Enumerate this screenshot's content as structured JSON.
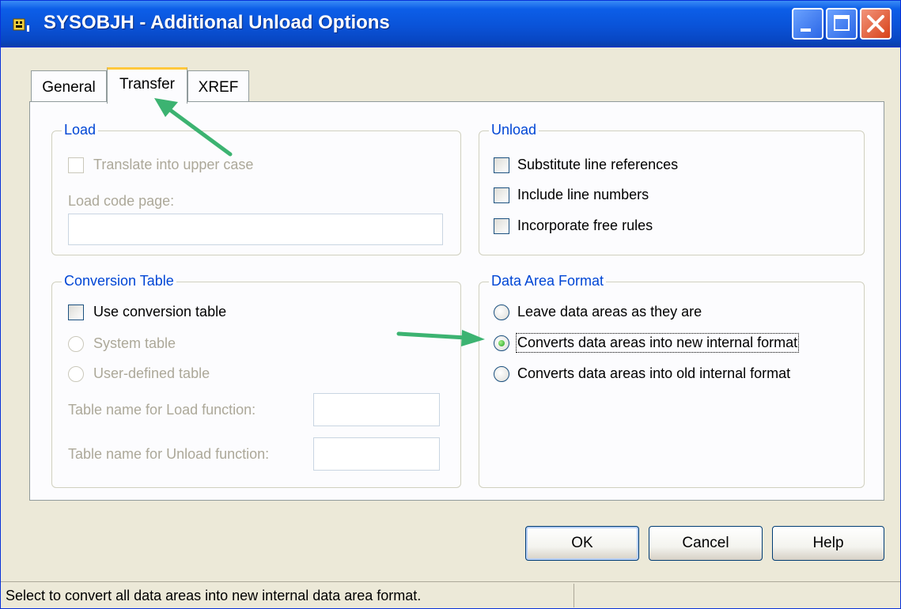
{
  "window": {
    "title": "SYSOBJH - Additional Unload Options",
    "controls": [
      "minimize-icon",
      "maximize-icon",
      "close-icon"
    ]
  },
  "tabs": [
    {
      "label": "General",
      "active": false
    },
    {
      "label": "Transfer",
      "active": true
    },
    {
      "label": "XREF",
      "active": false
    }
  ],
  "load": {
    "legend": "Load",
    "translate_upper": {
      "label": "Translate into upper case",
      "checked": false,
      "enabled": false
    },
    "code_page": {
      "label": "Load code page:",
      "value": "",
      "enabled": false
    }
  },
  "unload": {
    "legend": "Unload",
    "options": [
      {
        "label": "Substitute line references",
        "checked": false
      },
      {
        "label": "Include line numbers",
        "checked": false
      },
      {
        "label": "Incorporate free rules",
        "checked": false
      }
    ]
  },
  "conversion": {
    "legend": "Conversion Table",
    "use_table": {
      "label": "Use conversion table",
      "checked": false
    },
    "system_table": {
      "label": "System table",
      "enabled": false
    },
    "user_table": {
      "label": "User-defined table",
      "enabled": false
    },
    "load_name": {
      "label": "Table name for Load function:",
      "value": "",
      "enabled": false
    },
    "unload_name": {
      "label": "Table name for Unload function:",
      "value": "",
      "enabled": false
    }
  },
  "data_area": {
    "legend": "Data Area Format",
    "options": [
      {
        "label": "Leave data areas as they are",
        "selected": false
      },
      {
        "label": "Converts data areas into new internal format",
        "selected": true
      },
      {
        "label": "Converts data areas into old internal format",
        "selected": false
      }
    ]
  },
  "buttons": {
    "ok": "OK",
    "cancel": "Cancel",
    "help": "Help"
  },
  "status": "Select to convert all data areas into new internal data area format.",
  "colors": {
    "title_bar": "#0a53d8",
    "group_legend": "#0046d5",
    "annotation_arrow": "#3cb371",
    "tab_highlight": "#ffc83c"
  }
}
